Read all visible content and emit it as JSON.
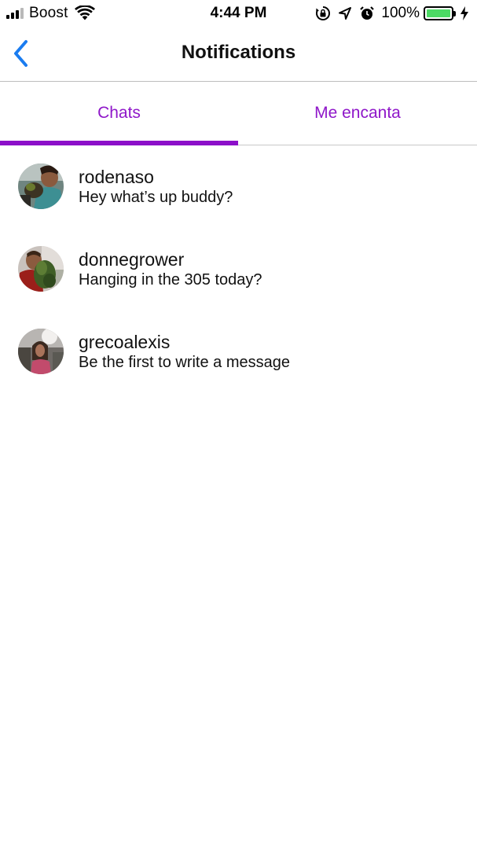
{
  "status_bar": {
    "carrier": "Boost",
    "time": "4:44 PM",
    "battery_percent": "100%",
    "battery_level": 1.0,
    "icons": [
      "signal-icon",
      "wifi-icon",
      "orientation-lock-icon",
      "location-icon",
      "alarm-icon",
      "battery-icon",
      "charging-icon"
    ]
  },
  "nav": {
    "title": "Notifications",
    "back_icon": "chevron-left-icon"
  },
  "tabs": [
    {
      "label": "Chats",
      "selected": true
    },
    {
      "label": "Me encanta",
      "selected": false
    }
  ],
  "chats": [
    {
      "name": "rodenaso",
      "message": "Hey what’s up buddy?"
    },
    {
      "name": "donnegrower",
      "message": "Hanging in the 305 today?"
    },
    {
      "name": "grecoalexis",
      "message": "Be the first to write a message"
    }
  ],
  "colors": {
    "accent": "#8c0fc9",
    "back": "#1a7cf0",
    "battery": "#4cd964"
  }
}
